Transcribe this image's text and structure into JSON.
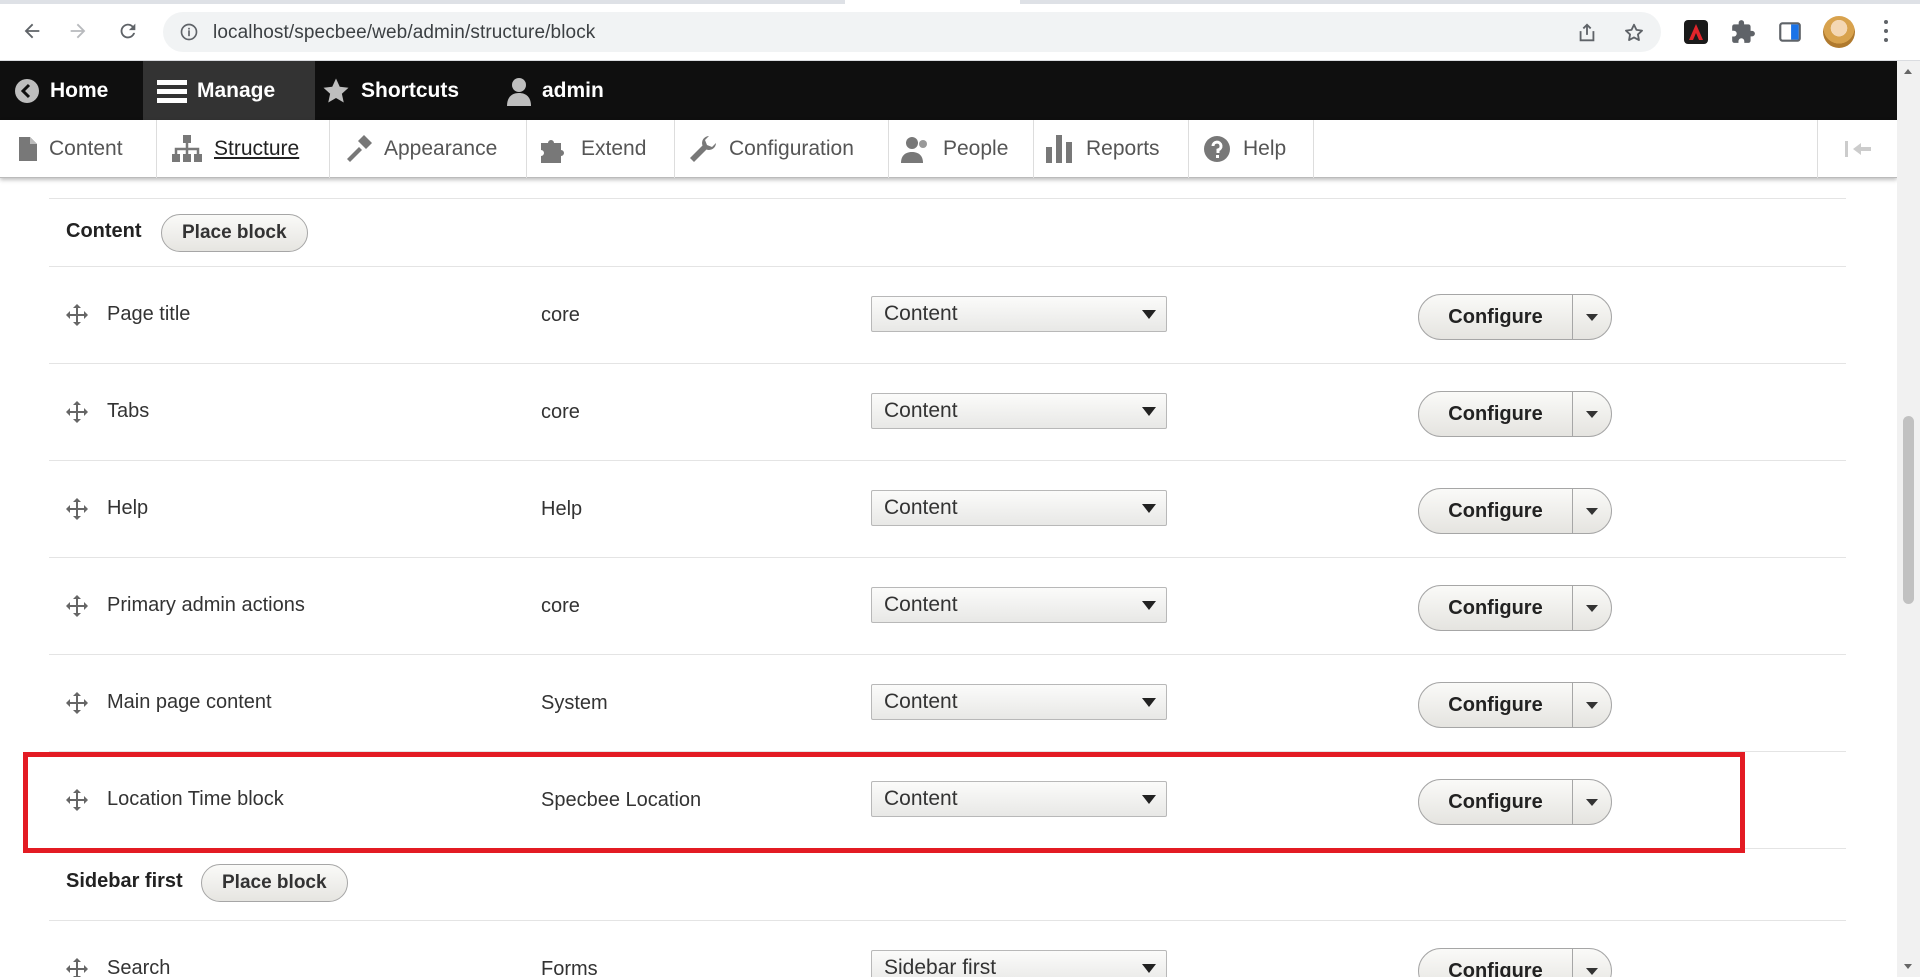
{
  "browser": {
    "url": "localhost/specbee/web/admin/structure/block"
  },
  "toolbar": {
    "items": [
      {
        "label": "Home",
        "icon": "drupal-home-icon"
      },
      {
        "label": "Manage",
        "icon": "hamburger-icon",
        "active": true
      },
      {
        "label": "Shortcuts",
        "icon": "star-icon"
      },
      {
        "label": "admin",
        "icon": "user-icon"
      }
    ]
  },
  "tray": {
    "items": [
      {
        "label": "Content",
        "icon": "document-icon"
      },
      {
        "label": "Structure",
        "icon": "sitemap-icon",
        "active": true
      },
      {
        "label": "Appearance",
        "icon": "paintbrush-icon"
      },
      {
        "label": "Extend",
        "icon": "puzzle-icon"
      },
      {
        "label": "Configuration",
        "icon": "wrench-icon"
      },
      {
        "label": "People",
        "icon": "people-icon"
      },
      {
        "label": "Reports",
        "icon": "bar-chart-icon"
      },
      {
        "label": "Help",
        "icon": "help-icon"
      }
    ]
  },
  "regions": [
    {
      "title": "Content",
      "button": "Place block"
    },
    {
      "title": "Sidebar first",
      "button": "Place block"
    }
  ],
  "blocks": [
    {
      "name": "Page title",
      "category": "core",
      "region": "Content",
      "op": "Configure"
    },
    {
      "name": "Tabs",
      "category": "core",
      "region": "Content",
      "op": "Configure"
    },
    {
      "name": "Help",
      "category": "Help",
      "region": "Content",
      "op": "Configure"
    },
    {
      "name": "Primary admin actions",
      "category": "core",
      "region": "Content",
      "op": "Configure"
    },
    {
      "name": "Main page content",
      "category": "System",
      "region": "Content",
      "op": "Configure"
    },
    {
      "name": "Location Time block",
      "category": "Specbee Location",
      "region": "Content",
      "op": "Configure",
      "highlighted": true
    },
    {
      "name": "Search",
      "category": "Forms",
      "region": "Sidebar first",
      "op": "Configure"
    }
  ],
  "colors": {
    "highlight": "#e31b23",
    "toolbar_bg": "#0f0f0f"
  }
}
